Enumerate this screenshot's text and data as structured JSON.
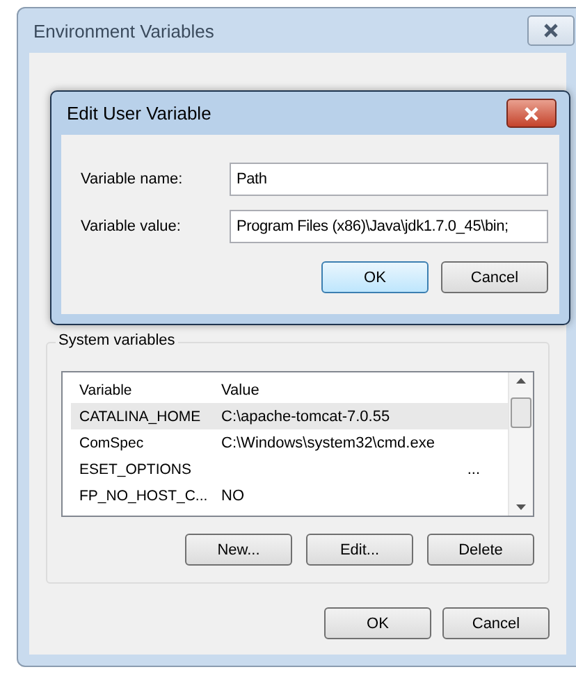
{
  "window": {
    "title": "Environment Variables"
  },
  "edit_dialog": {
    "title": "Edit User Variable",
    "fields": [
      {
        "label": "Variable name:",
        "value": "Path"
      },
      {
        "label": "Variable value:",
        "value": "Program Files (x86)\\Java\\jdk1.7.0_45\\bin;"
      }
    ],
    "buttons": [
      {
        "label": "OK",
        "kind": "default"
      },
      {
        "label": "Cancel",
        "kind": "normal"
      }
    ]
  },
  "system_variables": {
    "title": "System variables",
    "columns": [
      "Variable",
      "Value"
    ],
    "rows": [
      {
        "variable": "CATALINA_HOME",
        "value": "C:\\apache-tomcat-7.0.55",
        "selected": true
      },
      {
        "variable": "ComSpec",
        "value": "C:\\Windows\\system32\\cmd.exe",
        "selected": false
      },
      {
        "variable": "ESET_OPTIONS",
        "value": "...",
        "selected": false
      },
      {
        "variable": "FP_NO_HOST_C...",
        "value": "NO",
        "selected": false
      }
    ],
    "buttons": [
      "New...",
      "Edit...",
      "Delete"
    ]
  },
  "buttons": [
    "OK",
    "Cancel"
  ]
}
